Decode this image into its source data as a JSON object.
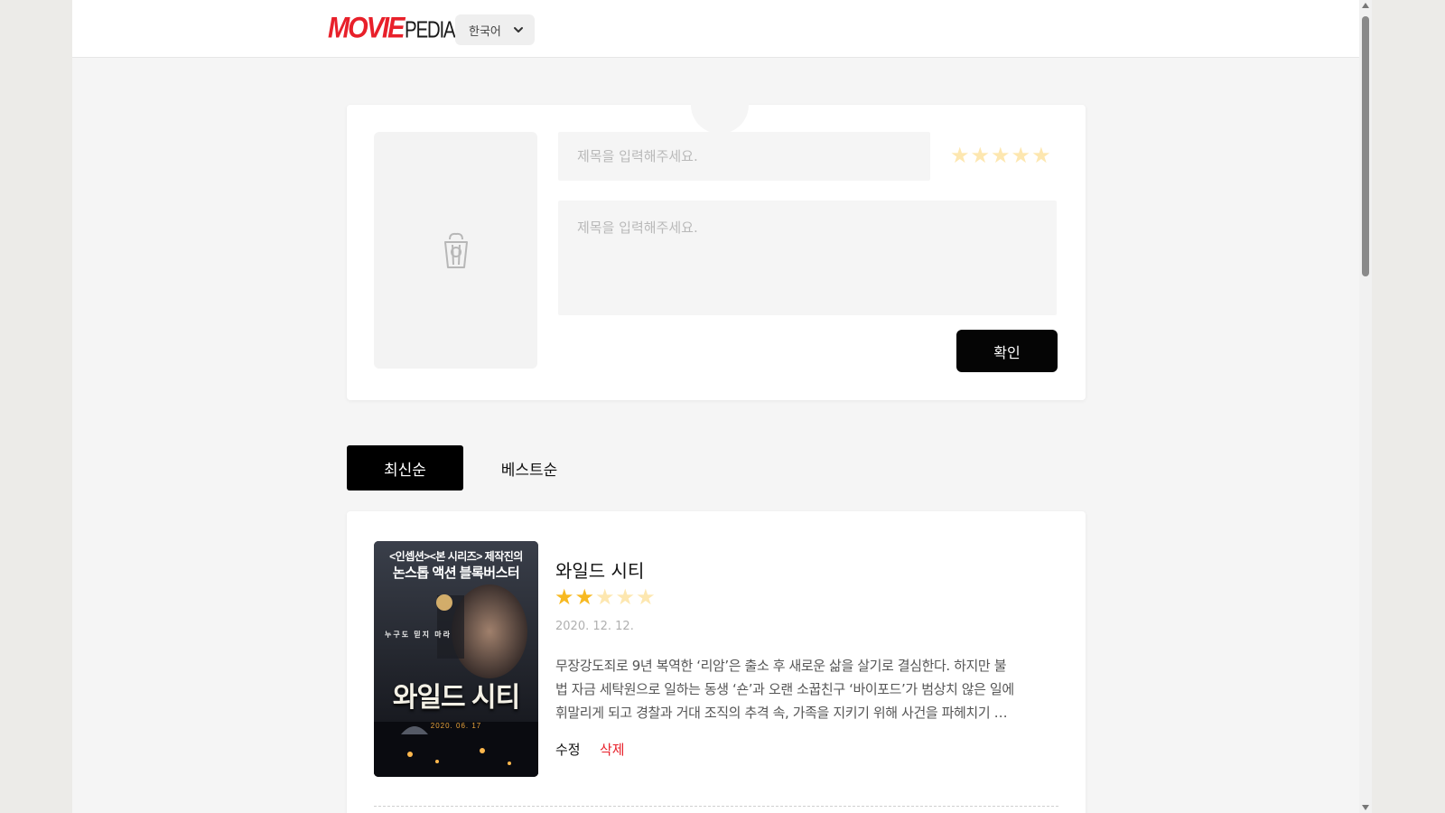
{
  "header": {
    "logo_movie": "MOVIE",
    "logo_pedia": "PEDIA",
    "language": "한국어"
  },
  "form": {
    "title_placeholder": "제목을 입력해주세요.",
    "content_placeholder": "제목을 입력해주세요.",
    "rating": 0,
    "confirm_label": "확인",
    "poster_icon": "popcorn-icon"
  },
  "tabs": [
    {
      "label": "최신순",
      "active": true
    },
    {
      "label": "베스트순",
      "active": false
    }
  ],
  "reviews": [
    {
      "title": "와일드 시티",
      "rating": 2,
      "max_rating": 5,
      "date": "2020. 12. 12.",
      "body_lines": [
        "무장강도죄로 9년 복역한 ‘리암’은 출소 후 새로운 삶을 살기로 결심한다. 하지만 불",
        "법 자금 세탁원으로 일하는 동생 ‘숀’과 오랜 소꿉친구 ‘바이포드’가 범상치 않은 일에",
        "휘말리게 되고 경찰과 거대 조직의 추격 속, 가족을 지키기 위해 사건을 파헤치기 …"
      ],
      "edit_label": "수정",
      "delete_label": "삭제",
      "poster": {
        "top_line1": "<인셉션><본 시리즈> 제작진의",
        "top_line2": "논스톱 액션 블록버스터",
        "tagline": "누구도 믿지 마라",
        "title": "와일드 시티",
        "date": "2020. 06. 17"
      }
    }
  ],
  "colors": {
    "brand_red": "#e8202a",
    "star_filled": "#f7b921",
    "star_empty": "#fde7b0",
    "button_black": "#050505"
  }
}
